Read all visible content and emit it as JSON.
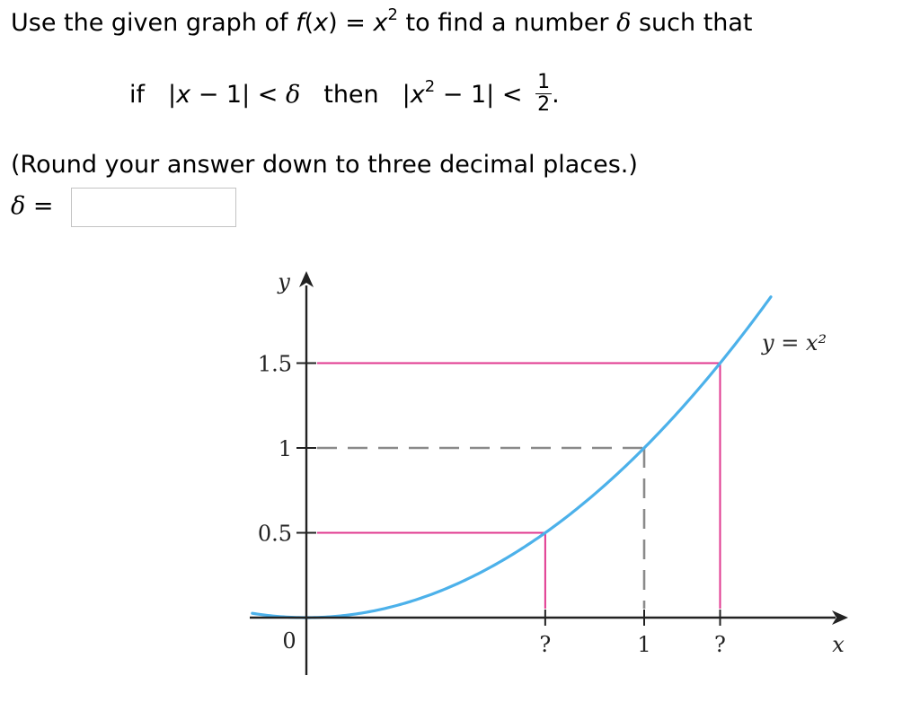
{
  "question": {
    "line1_prefix": "Use the given graph of ",
    "fx_func": "f",
    "fx_open": "(",
    "fx_var": "x",
    "fx_close": ")",
    "fx_equals": " = ",
    "fx_rhs_var": "x",
    "fx_rhs_exp": "2",
    "line1_mid": " to find a number ",
    "delta_symbol": "δ",
    "line1_suffix": " such that",
    "if_word": "if",
    "cond1_open": "|",
    "cond1_var": "x",
    "cond1_rest": " − 1| < ",
    "then_word": "then",
    "cond2_open": "|",
    "cond2_var": "x",
    "cond2_exp": "2",
    "cond2_rest": " − 1| < ",
    "frac_num": "1",
    "frac_den": "2",
    "period": ".",
    "instruction": "(Round your answer down to three decimal places.)",
    "answer_label_eq": " = ",
    "answer_value": ""
  },
  "colors": {
    "curve": "#4cb1ea",
    "guide_lines": "#e0388f",
    "dashed_lines": "#8a8a8a",
    "axes": "#222222",
    "input_border": "#c3c3c3"
  },
  "chart_data": {
    "type": "line",
    "title": "",
    "function": "y = x^2",
    "curve_label": "y = x²",
    "xlabel": "x",
    "ylabel": "y",
    "xlim": [
      -0.16,
      1.375
    ],
    "ylim": [
      0,
      1.89
    ],
    "x_ticks": [
      {
        "value": 0.7071,
        "label": "?"
      },
      {
        "value": 1,
        "label": "1"
      },
      {
        "value": 1.2247,
        "label": "?"
      }
    ],
    "y_ticks": [
      {
        "value": 1.5,
        "label": "1.5"
      },
      {
        "value": 1,
        "label": "1"
      },
      {
        "value": 0.5,
        "label": "0.5"
      }
    ],
    "origin_label": "0",
    "guides": [
      {
        "x": 0.7071,
        "y": 0.5,
        "style": "solid",
        "color": "pink"
      },
      {
        "x": 1.2247,
        "y": 1.5,
        "style": "solid",
        "color": "pink"
      },
      {
        "x": 1,
        "y": 1,
        "style": "dashed",
        "color": "gray"
      }
    ],
    "grid": false,
    "legend": "none"
  }
}
